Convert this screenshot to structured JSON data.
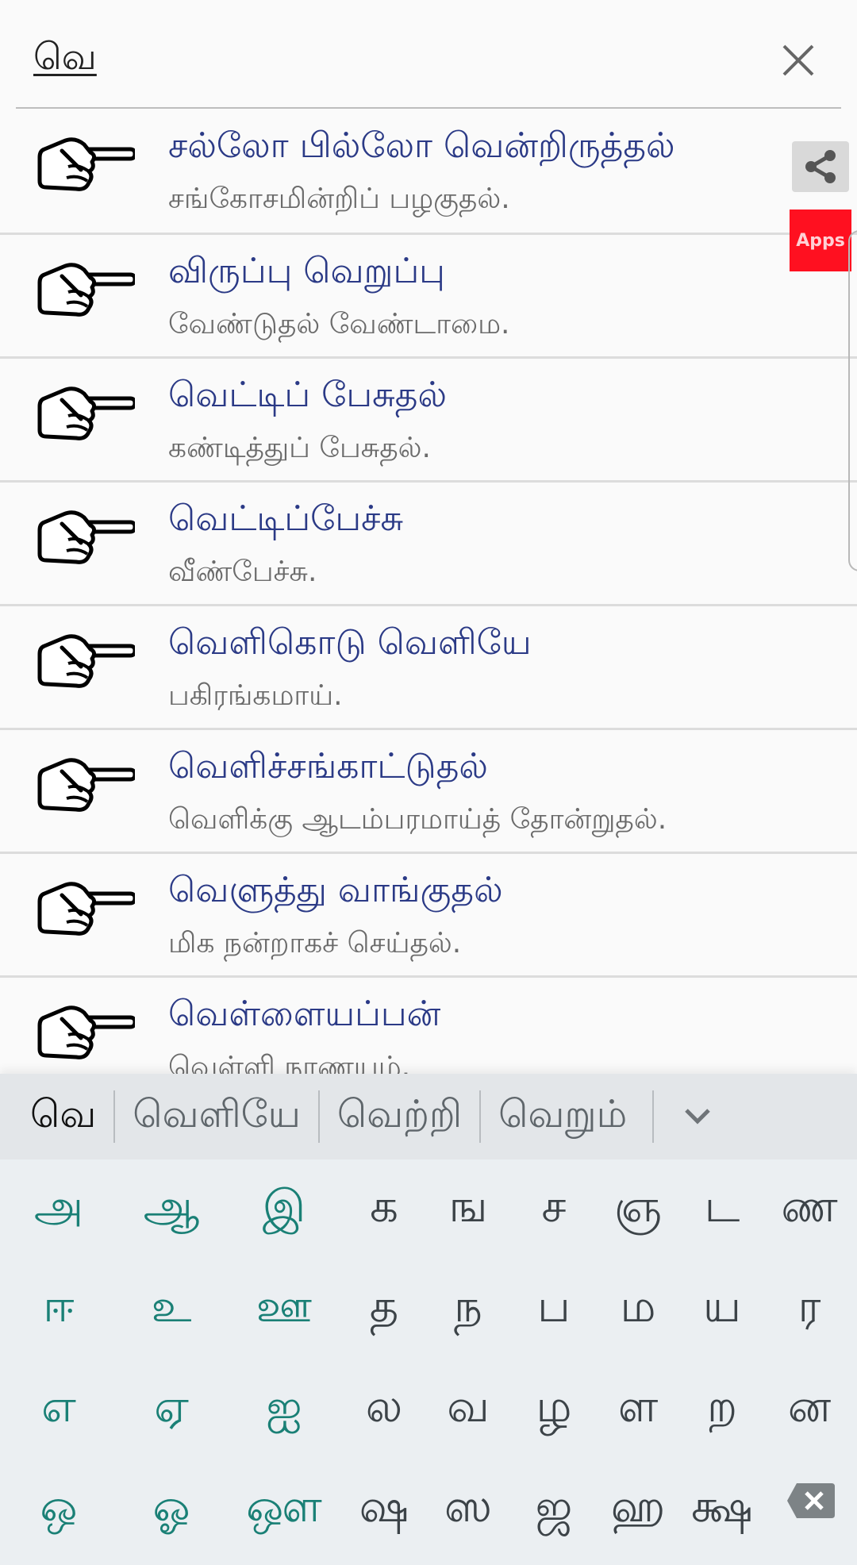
{
  "search": {
    "query": "வெ",
    "clear_icon": "close-icon"
  },
  "results": [
    {
      "title": "சல்லோ பில்லோ வென்றிருத்தல்",
      "meaning": "சங்கோசமின்றிப்  பழகுதல்."
    },
    {
      "title": "விருப்பு வெறுப்பு",
      "meaning": "வேண்டுதல் வேண்டாமை."
    },
    {
      "title": "வெட்டிப் பேசுதல்",
      "meaning": "கண்டித்துப் பேசுதல்."
    },
    {
      "title": "வெட்டிப்பேச்சு",
      "meaning": "வீண்பேச்சு."
    },
    {
      "title": "வெளிகொடு வெளியே",
      "meaning": "பகிரங்கமாய்."
    },
    {
      "title": "வெளிச்சங்காட்டுதல்",
      "meaning": "வெளிக்கு ஆடம்பரமாய்த் தோன்றுதல்."
    },
    {
      "title": "வெளுத்து வாங்குதல்",
      "meaning": "மிக நன்றாகச் செய்தல்."
    },
    {
      "title": "வெள்ளையப்பன்",
      "meaning": "வெள்ளி நாணயம்."
    }
  ],
  "floating": {
    "share_icon": "share-icon",
    "apps_label": "Apps"
  },
  "keyboard": {
    "suggestions": {
      "typed": "வெ",
      "words": [
        "வெளியே",
        "வெற்றி",
        "வெறும்"
      ],
      "expand_icon": "chevron-down-icon"
    },
    "rows": [
      [
        {
          "char": "அ",
          "vowel": true
        },
        {
          "char": "ஆ",
          "vowel": true
        },
        {
          "char": "இ",
          "vowel": true
        },
        {
          "char": "க",
          "vowel": false
        },
        {
          "char": "ங",
          "vowel": false
        },
        {
          "char": "ச",
          "vowel": false
        },
        {
          "char": "ஞ",
          "vowel": false
        },
        {
          "char": "ட",
          "vowel": false
        },
        {
          "char": "ண",
          "vowel": false
        }
      ],
      [
        {
          "char": "ஈ",
          "vowel": true
        },
        {
          "char": "உ",
          "vowel": true
        },
        {
          "char": "ஊ",
          "vowel": true
        },
        {
          "char": "த",
          "vowel": false
        },
        {
          "char": "ந",
          "vowel": false
        },
        {
          "char": "ப",
          "vowel": false
        },
        {
          "char": "ம",
          "vowel": false
        },
        {
          "char": "ய",
          "vowel": false
        },
        {
          "char": "ர",
          "vowel": false
        }
      ],
      [
        {
          "char": "எ",
          "vowel": true
        },
        {
          "char": "ஏ",
          "vowel": true
        },
        {
          "char": "ஐ",
          "vowel": true
        },
        {
          "char": "ல",
          "vowel": false
        },
        {
          "char": "வ",
          "vowel": false
        },
        {
          "char": "ழ",
          "vowel": false
        },
        {
          "char": "ள",
          "vowel": false
        },
        {
          "char": "ற",
          "vowel": false
        },
        {
          "char": "ன",
          "vowel": false
        }
      ],
      [
        {
          "char": "ஒ",
          "vowel": true
        },
        {
          "char": "ஓ",
          "vowel": true
        },
        {
          "char": "ஔ",
          "vowel": true
        },
        {
          "char": "ஷ",
          "vowel": false
        },
        {
          "char": "ஸ",
          "vowel": false
        },
        {
          "char": "ஜ",
          "vowel": false
        },
        {
          "char": "ஹ",
          "vowel": false
        },
        {
          "char": "க்ஷ",
          "vowel": false
        }
      ]
    ],
    "backspace_icon": "backspace-icon"
  },
  "colors": {
    "title": "#2b3a86",
    "meaning": "#6b6b6b",
    "vowel_key": "#1a8076",
    "consonant_key": "#3c4348",
    "apps_badge": "#ff1020"
  }
}
